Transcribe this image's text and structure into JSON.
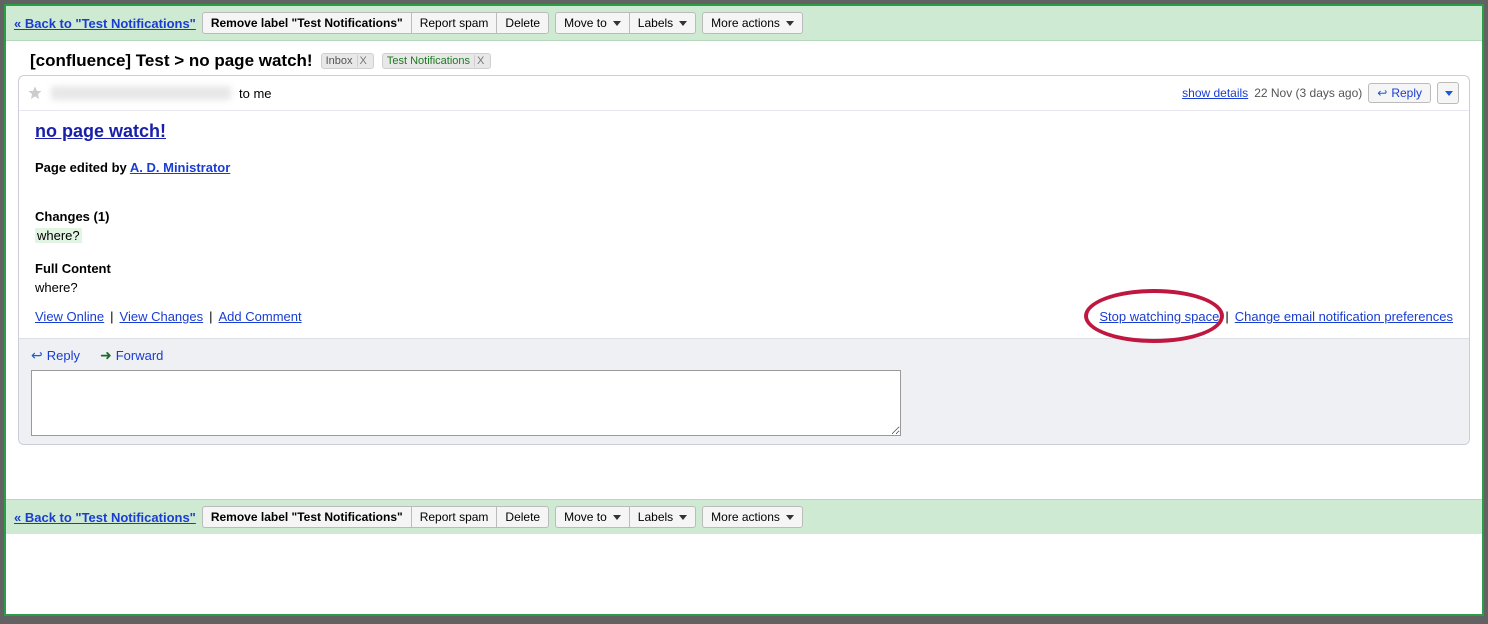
{
  "toolbar": {
    "back_link": "« Back to \"Test Notifications\"",
    "remove_label": "Remove label \"Test Notifications\"",
    "report_spam": "Report spam",
    "delete": "Delete",
    "move_to": "Move to",
    "labels": "Labels",
    "more_actions": "More actions"
  },
  "subject": "[confluence] Test > no page watch!",
  "labels": {
    "inbox": "Inbox",
    "test_notifications": "Test Notifications"
  },
  "msg_head": {
    "to_me": "to me",
    "show_details": "show details",
    "date": "22 Nov (3 days ago)",
    "reply": "Reply"
  },
  "body": {
    "title": "no page watch!",
    "page_edited_by": "Page edited by ",
    "author": "A. D. Ministrator",
    "changes_heading": "Changes (1)",
    "changes_text": "where?",
    "full_content_heading": "Full Content",
    "full_content_text": "where?",
    "view_online": "View Online",
    "view_changes": "View Changes",
    "add_comment": "Add Comment",
    "stop_watching": "Stop watching space",
    "change_prefs": "Change email notification preferences"
  },
  "reply_strip": {
    "reply": "Reply",
    "forward": "Forward"
  }
}
